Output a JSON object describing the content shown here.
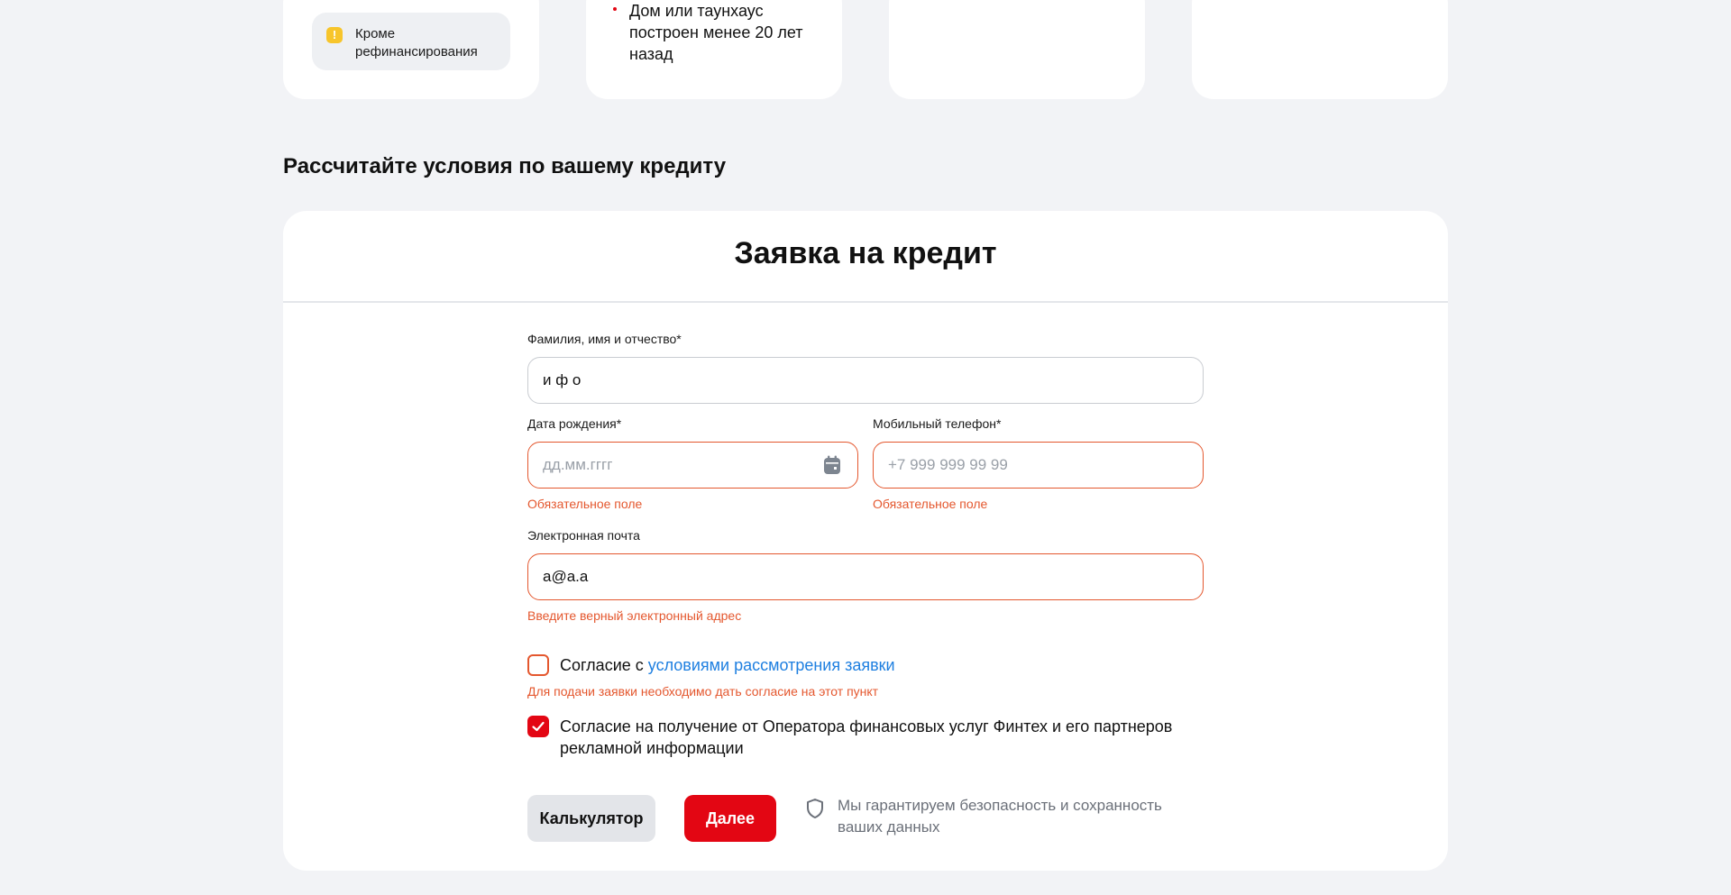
{
  "top_cards": {
    "card1_notice": "Кроме рефинансирования",
    "card2_bullet": "Дом или таунхаус построен менее 20 лет назад"
  },
  "section_title": "Рассчитайте условия по вашему кредиту",
  "form": {
    "title": "Заявка на кредит",
    "full_name": {
      "label": "Фамилия, имя и отчество*",
      "value": "и ф о"
    },
    "birth_date": {
      "label": "Дата рождения*",
      "placeholder": "дд.мм.гггг",
      "error": "Обязательное поле"
    },
    "phone": {
      "label": "Мобильный телефон*",
      "placeholder": "+7 999 999 99 99",
      "error": "Обязательное поле"
    },
    "email": {
      "label": "Электронная почта",
      "value": "a@a.a",
      "error": "Введите верный электронный адрес"
    },
    "consent_terms": {
      "prefix": "Согласие с ",
      "link": "условиями рассмотрения заявки",
      "checked": false,
      "error": "Для подачи заявки необходимо дать согласие на этот пункт"
    },
    "consent_ads": {
      "text": "Согласие на получение от Оператора финансовых услуг Финтех и его партнеров рекламной информации",
      "checked": true
    },
    "buttons": {
      "calculator": "Калькулятор",
      "next": "Далее"
    },
    "security_note": "Мы гарантируем безопасность и сохранность ваших данных"
  },
  "colors": {
    "brand_red": "#e30613",
    "error": "#e4572e",
    "link": "#1e7fe0",
    "warning": "#f7c52b"
  },
  "icons": [
    "warning-icon",
    "calendar-icon",
    "checkmark-icon",
    "shield-icon"
  ]
}
